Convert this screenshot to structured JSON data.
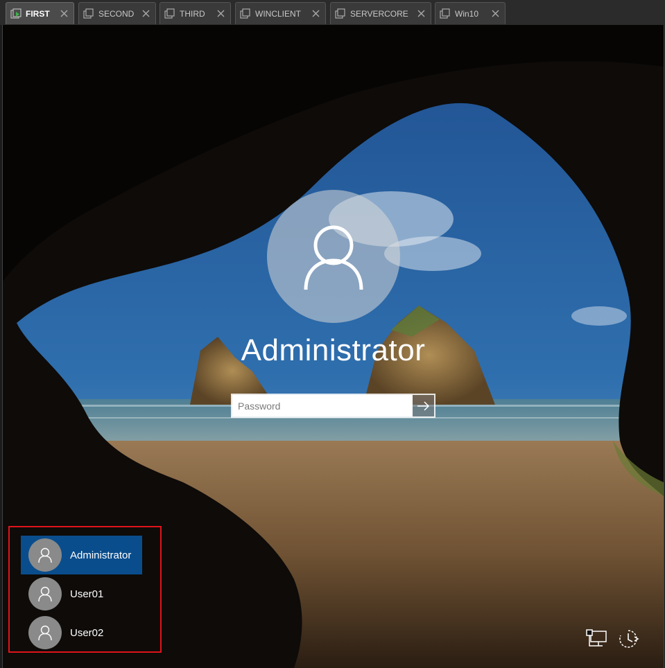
{
  "tabs": [
    {
      "label": "FIRST",
      "active": true
    },
    {
      "label": "SECOND",
      "active": false
    },
    {
      "label": "THIRD",
      "active": false
    },
    {
      "label": "WINCLIENT",
      "active": false
    },
    {
      "label": "SERVERCORE",
      "active": false
    },
    {
      "label": "Win10",
      "active": false
    }
  ],
  "login": {
    "username": "Administrator",
    "password_placeholder": "Password",
    "password_value": ""
  },
  "user_list": {
    "users": [
      {
        "name": "Administrator",
        "selected": true
      },
      {
        "name": "User01",
        "selected": false
      },
      {
        "name": "User02",
        "selected": false
      }
    ]
  },
  "icons": {
    "tab": "window-icon",
    "tab_active": "window-play-icon",
    "close": "close-icon",
    "avatar": "user-icon",
    "submit": "arrow-right-icon",
    "network": "network-icon",
    "ease_of_access": "ease-of-access-icon"
  },
  "colors": {
    "selected_user": "#0a4d8c",
    "highlight_border": "#e0141b",
    "active_tab_accent": "#3cb34a"
  }
}
